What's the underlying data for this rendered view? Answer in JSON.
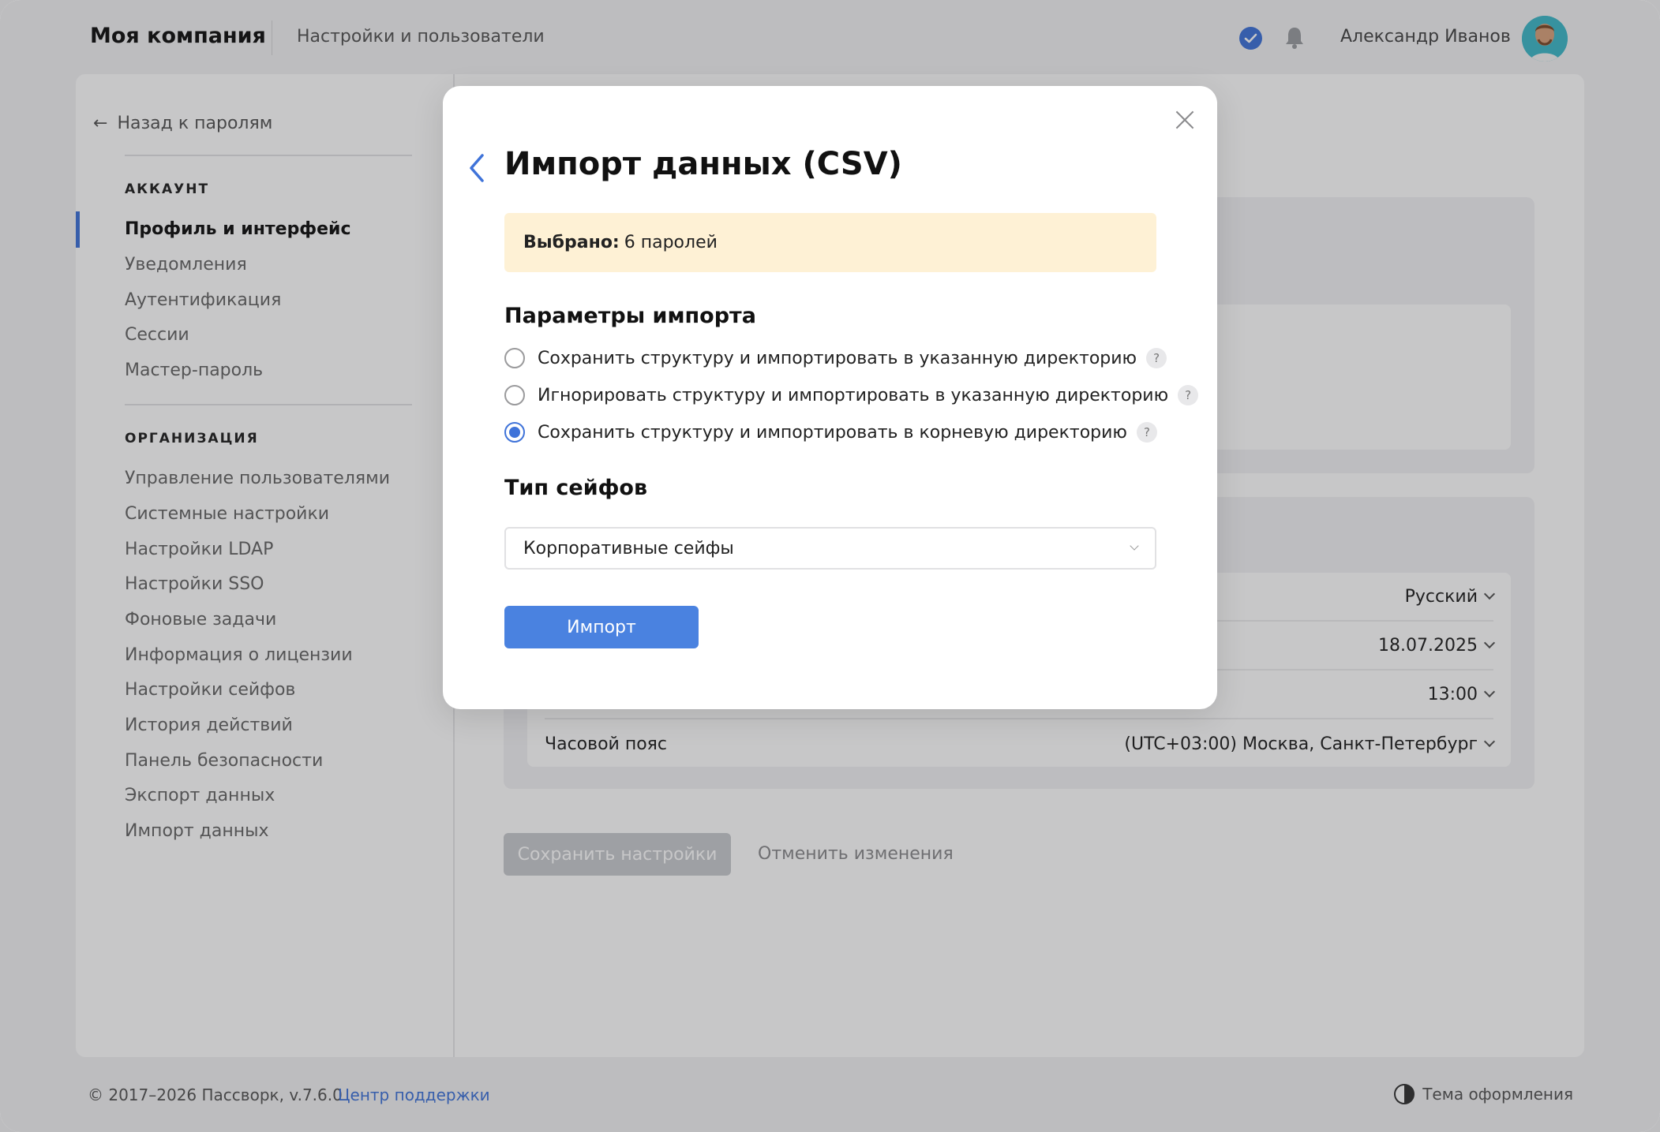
{
  "header": {
    "brand": "Моя компания",
    "section": "Настройки и пользователи",
    "user_name": "Александр Иванов"
  },
  "sidebar": {
    "back_label": "Назад к паролям",
    "account_heading": "АККАУНТ",
    "account_items": [
      {
        "label": "Профиль и интерфейс",
        "active": true
      },
      {
        "label": "Уведомления"
      },
      {
        "label": "Аутентификация"
      },
      {
        "label": "Сессии"
      },
      {
        "label": "Мастер-пароль"
      }
    ],
    "org_heading": "ОРГАНИЗАЦИЯ",
    "org_items": [
      {
        "label": "Управление пользователями"
      },
      {
        "label": "Системные настройки"
      },
      {
        "label": "Настройки LDAP"
      },
      {
        "label": "Настройки SSO"
      },
      {
        "label": "Фоновые задачи"
      },
      {
        "label": "Информация о лицензии"
      },
      {
        "label": "Настройки сейфов"
      },
      {
        "label": "История действий"
      },
      {
        "label": "Панель безопасности"
      },
      {
        "label": "Экспорт данных"
      },
      {
        "label": "Импорт данных"
      }
    ]
  },
  "settings": {
    "language_value": "Русский",
    "date_value": "18.07.2025",
    "time_value": "13:00",
    "timezone_label": "Часовой пояс",
    "timezone_value": "(UTC+03:00) Москва, Санкт-Петербург",
    "save_label": "Сохранить настройки",
    "cancel_label": "Отменить изменения"
  },
  "footer": {
    "copyright": "© 2017–2026 Пассворк, v.7.6.0",
    "support": "Центр поддержки",
    "theme": "Тема оформления"
  },
  "modal": {
    "title": "Импорт данных (CSV)",
    "selected_label": "Выбрано:",
    "selected_value": "6 паролей",
    "params_title": "Параметры импорта",
    "options": [
      {
        "label": "Сохранить структуру и импортировать в указанную директорию",
        "checked": false
      },
      {
        "label": "Игнорировать структуру и импортировать в указанную директорию",
        "checked": false
      },
      {
        "label": "Сохранить структуру и импортировать в корневую директорию",
        "checked": true
      }
    ],
    "help_glyph": "?",
    "vault_type_title": "Тип сейфов",
    "vault_type_value": "Корпоративные сейфы",
    "import_label": "Импорт"
  },
  "colors": {
    "accent": "#3f73d9",
    "button": "#4a82e0",
    "info_bg": "#fef1d5"
  }
}
